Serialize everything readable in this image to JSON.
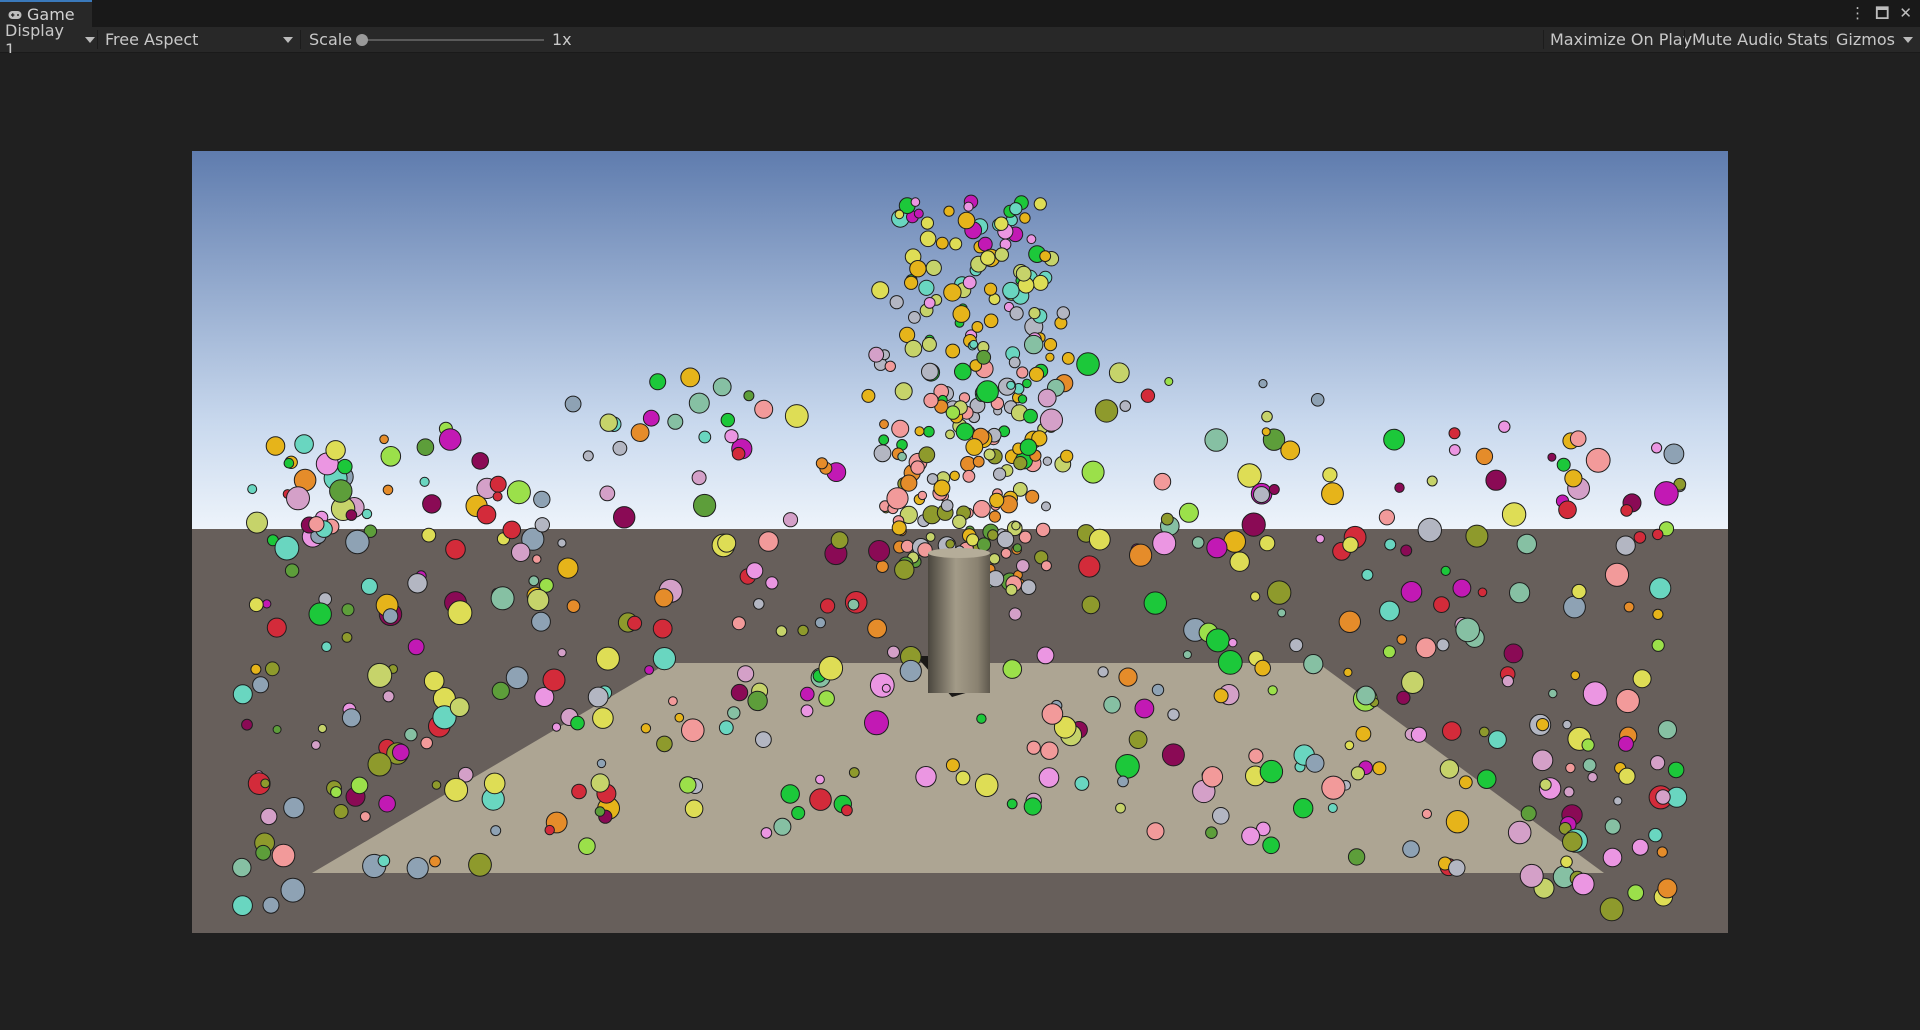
{
  "tab": {
    "title": "Game",
    "icon": "gamepad-icon"
  },
  "window_controls": {
    "more": "⋮",
    "maximize": "🗖",
    "close": "✕"
  },
  "toolbar": {
    "display": "Display 1",
    "aspect": "Free Aspect",
    "scale_label": "Scale",
    "scale_value": "1x",
    "scale_level": 0,
    "maximize_on_play": "Maximize On Play",
    "mute_audio": "Mute Audio",
    "stats": "Stats",
    "gizmos": "Gizmos"
  },
  "scene": {
    "sky_top": "#5f7cae",
    "sky_horizon": "#eef4fb",
    "ground": "#675f5b",
    "platform": "#ada593",
    "pillar": "#8a8271",
    "palette": [
      "#f29a9a",
      "#e58c2a",
      "#8e9a2c",
      "#5d9e3a",
      "#86c0a3",
      "#8ea2b4",
      "#d4a0c8",
      "#9be04a",
      "#d32b3a",
      "#8a0a55",
      "#c219b4",
      "#dedd55",
      "#eb96e2",
      "#69d6c0",
      "#1cc83a",
      "#e6b41a",
      "#c6d36a",
      "#b3b6c2"
    ]
  }
}
